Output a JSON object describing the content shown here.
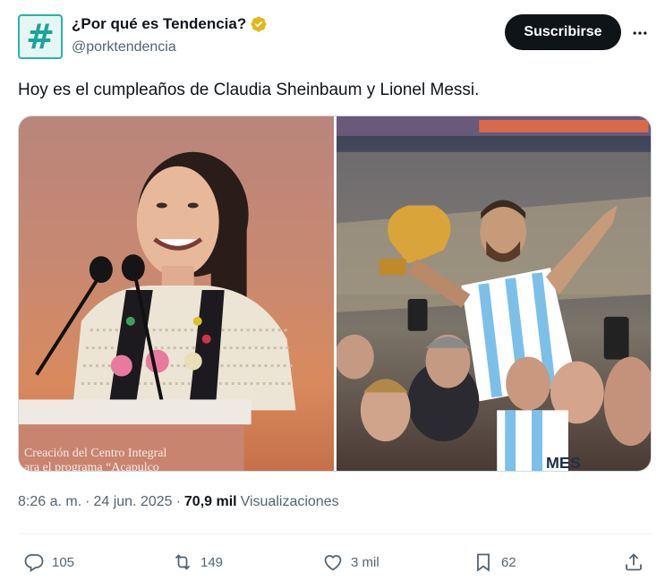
{
  "account": {
    "display_name": "¿Por qué es Tendencia?",
    "handle": "@porktendencia",
    "avatar_symbol": "#",
    "verified_color": "#e2b719"
  },
  "header": {
    "subscribe_label": "Suscribirse",
    "more_icon": "more-horizontal-icon"
  },
  "tweet": {
    "text": "Hoy es el cumpleaños de Claudia Sheinbaum y Lionel Messi."
  },
  "media": {
    "photo1": {
      "podium_text_line1": "Creación del Centro Integral",
      "podium_text_line2": "ara el programa “Acapulco"
    },
    "photo2": {
      "jersey_text": "MES"
    }
  },
  "meta": {
    "time": "8:26 a. m.",
    "separator": "·",
    "date": "24 jun. 2025",
    "views_count": "70,9 mil",
    "views_label": "Visualizaciones"
  },
  "actions": {
    "replies": "105",
    "reposts": "149",
    "likes": "3 mil",
    "bookmarks": "62"
  },
  "colors": {
    "text_primary": "#0f1419",
    "text_secondary": "#536471",
    "button_dark": "#0f1419",
    "avatar_teal": "#1aa59a"
  }
}
